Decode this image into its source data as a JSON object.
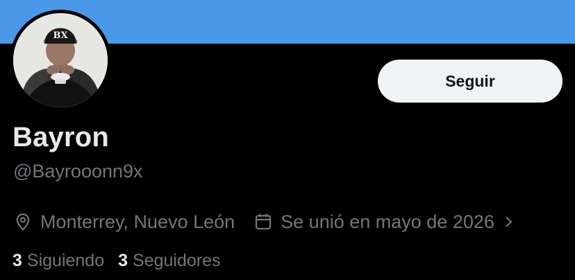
{
  "profile": {
    "display_name": "Bayron",
    "handle": "@Bayrooonn9x",
    "avatar_icon": "profile-photo",
    "location": "Monterrey, Nuevo León",
    "joined": "Se unió en mayo de 2026"
  },
  "actions": {
    "follow_label": "Seguir"
  },
  "stats": {
    "following_count": "3",
    "following_label": "Siguiendo",
    "followers_count": "3",
    "followers_label": "Seguidores"
  },
  "colors": {
    "banner": "#4a99e9",
    "background": "#000000",
    "primary_text": "#e7e9ea",
    "secondary_text": "#71767b",
    "button_bg": "#eff3f4"
  },
  "icons": {
    "location": "location-pin-icon",
    "calendar": "calendar-icon",
    "chevron": "chevron-right-icon"
  }
}
